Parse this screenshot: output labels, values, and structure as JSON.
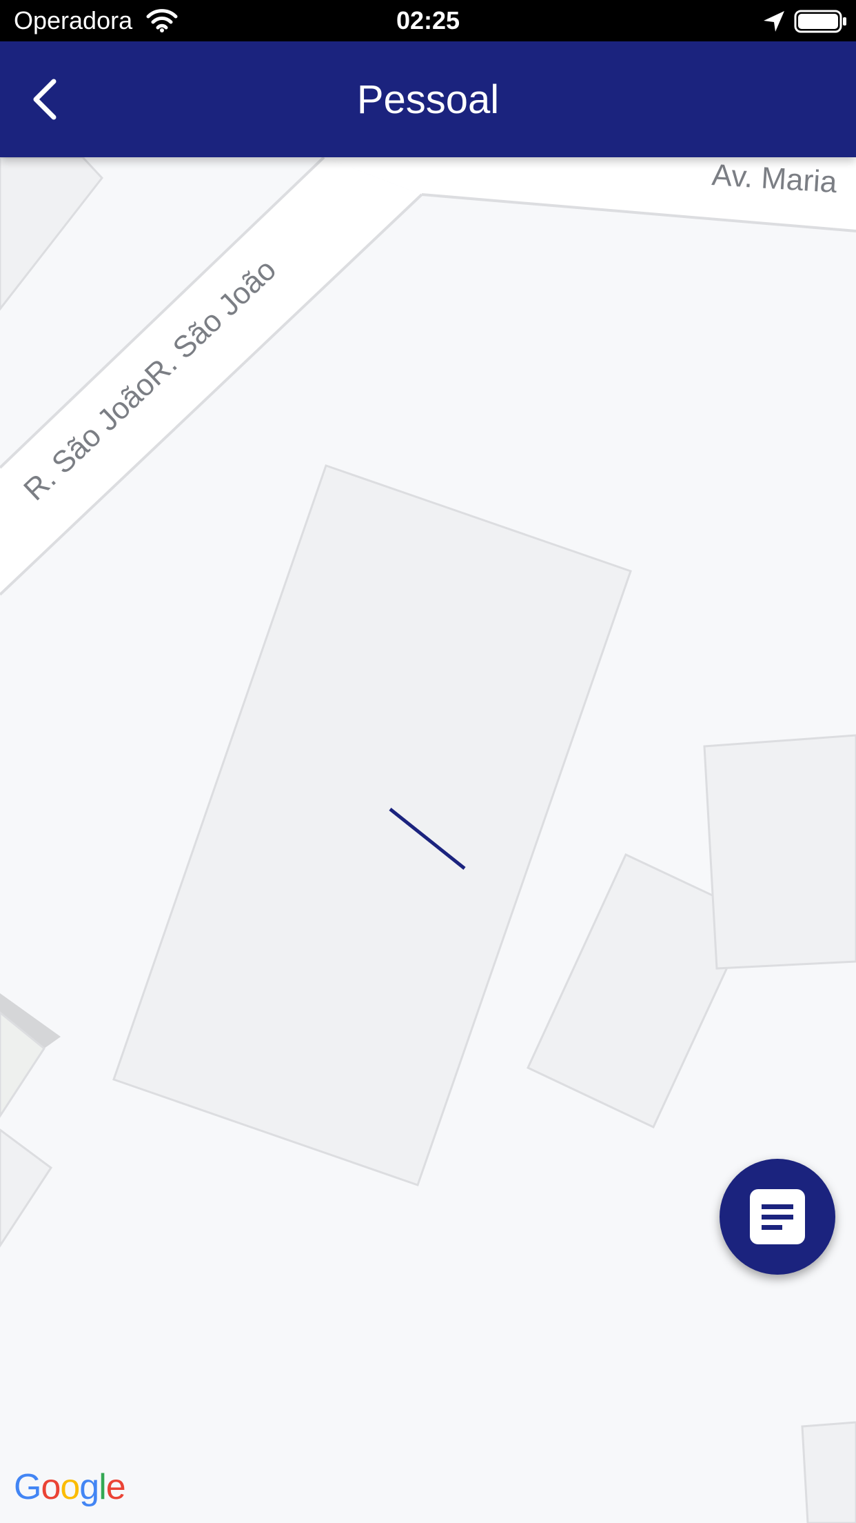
{
  "status_bar": {
    "carrier": "Operadora",
    "time": "02:25",
    "icons": [
      "wifi-icon",
      "location-arrow-icon",
      "battery-icon"
    ]
  },
  "nav_bar": {
    "title": "Pessoal",
    "back_icon": "chevron-left-icon",
    "background_color": "#1b237e"
  },
  "map": {
    "street_labels": {
      "diagonal": "R. São JoãoR. São João",
      "top_right": "Av. Maria"
    },
    "attribution": {
      "g1": "G",
      "o1": "o",
      "o2": "o",
      "g2": "g",
      "l": "l",
      "e": "e"
    }
  },
  "fab": {
    "icon": "document-icon",
    "color": "#1b237e"
  },
  "colors": {
    "map_background": "#f7f8fa",
    "building_fill": "#f0f1f3",
    "building_stroke": "#dcdde0",
    "road_fill": "#ffffff",
    "route_line": "#1b237e"
  }
}
